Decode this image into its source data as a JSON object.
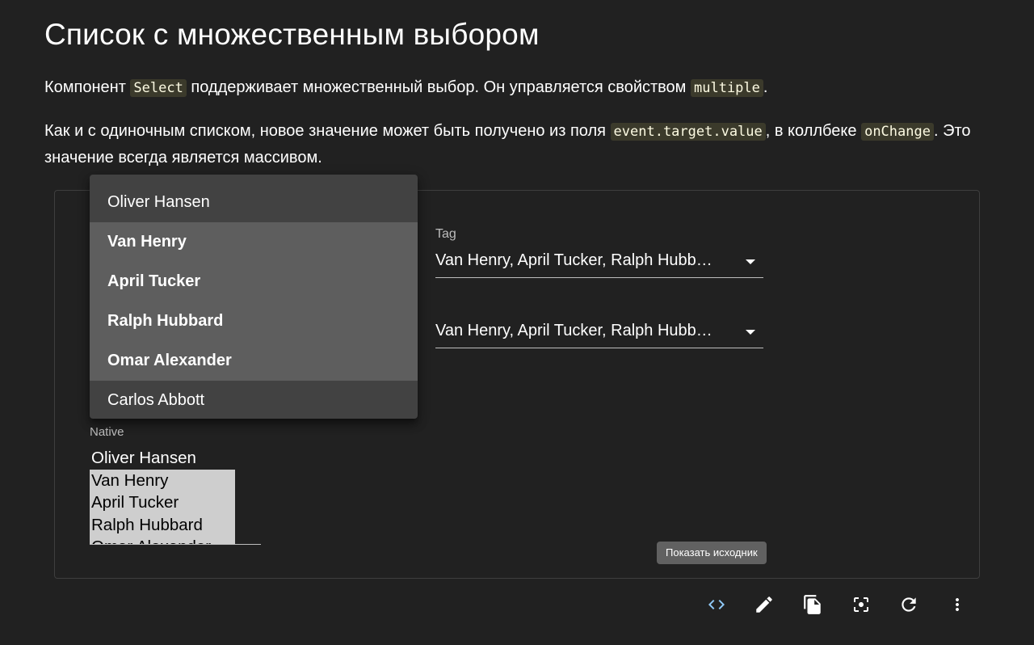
{
  "heading": "Список с множественным выбором",
  "paragraph1": {
    "part1": "Компонент ",
    "code1": "Select",
    "part2": " поддерживает множественный выбор. Он управляется свойством ",
    "code2": "multiple",
    "part3": "."
  },
  "paragraph2": {
    "part1": "Как и с одиночным списком, новое значение может быть получено из поля ",
    "code1": "event.target.value",
    "part2": ", в коллбеке ",
    "code2": "onChange",
    "part3": ". Это значение всегда является массивом."
  },
  "tag_select": {
    "label": "Tag",
    "value": "Van Henry, April Tucker, Ralph Hubb…"
  },
  "second_select": {
    "value": "Van Henry, April Tucker, Ralph Hubb…"
  },
  "menu": {
    "items": [
      {
        "label": "Oliver Hansen",
        "selected": false
      },
      {
        "label": "Van Henry",
        "selected": true
      },
      {
        "label": "April Tucker",
        "selected": true
      },
      {
        "label": "Ralph Hubbard",
        "selected": true
      },
      {
        "label": "Omar Alexander",
        "selected": true
      },
      {
        "label": "Carlos Abbott",
        "selected": false
      }
    ]
  },
  "native": {
    "label": "Native",
    "options": [
      {
        "label": "Oliver Hansen",
        "selected": false
      },
      {
        "label": "Van Henry",
        "selected": true
      },
      {
        "label": "April Tucker",
        "selected": true
      },
      {
        "label": "Ralph Hubbard",
        "selected": true
      },
      {
        "label": "Omar Alexander",
        "selected": true
      }
    ]
  },
  "tooltip": "Показать исходник",
  "toolbar": {
    "icons": [
      "code-icon",
      "edit-icon",
      "copy-icon",
      "screenshot-icon",
      "refresh-icon",
      "more-vert-icon"
    ],
    "accent_color": "#90caf9"
  }
}
